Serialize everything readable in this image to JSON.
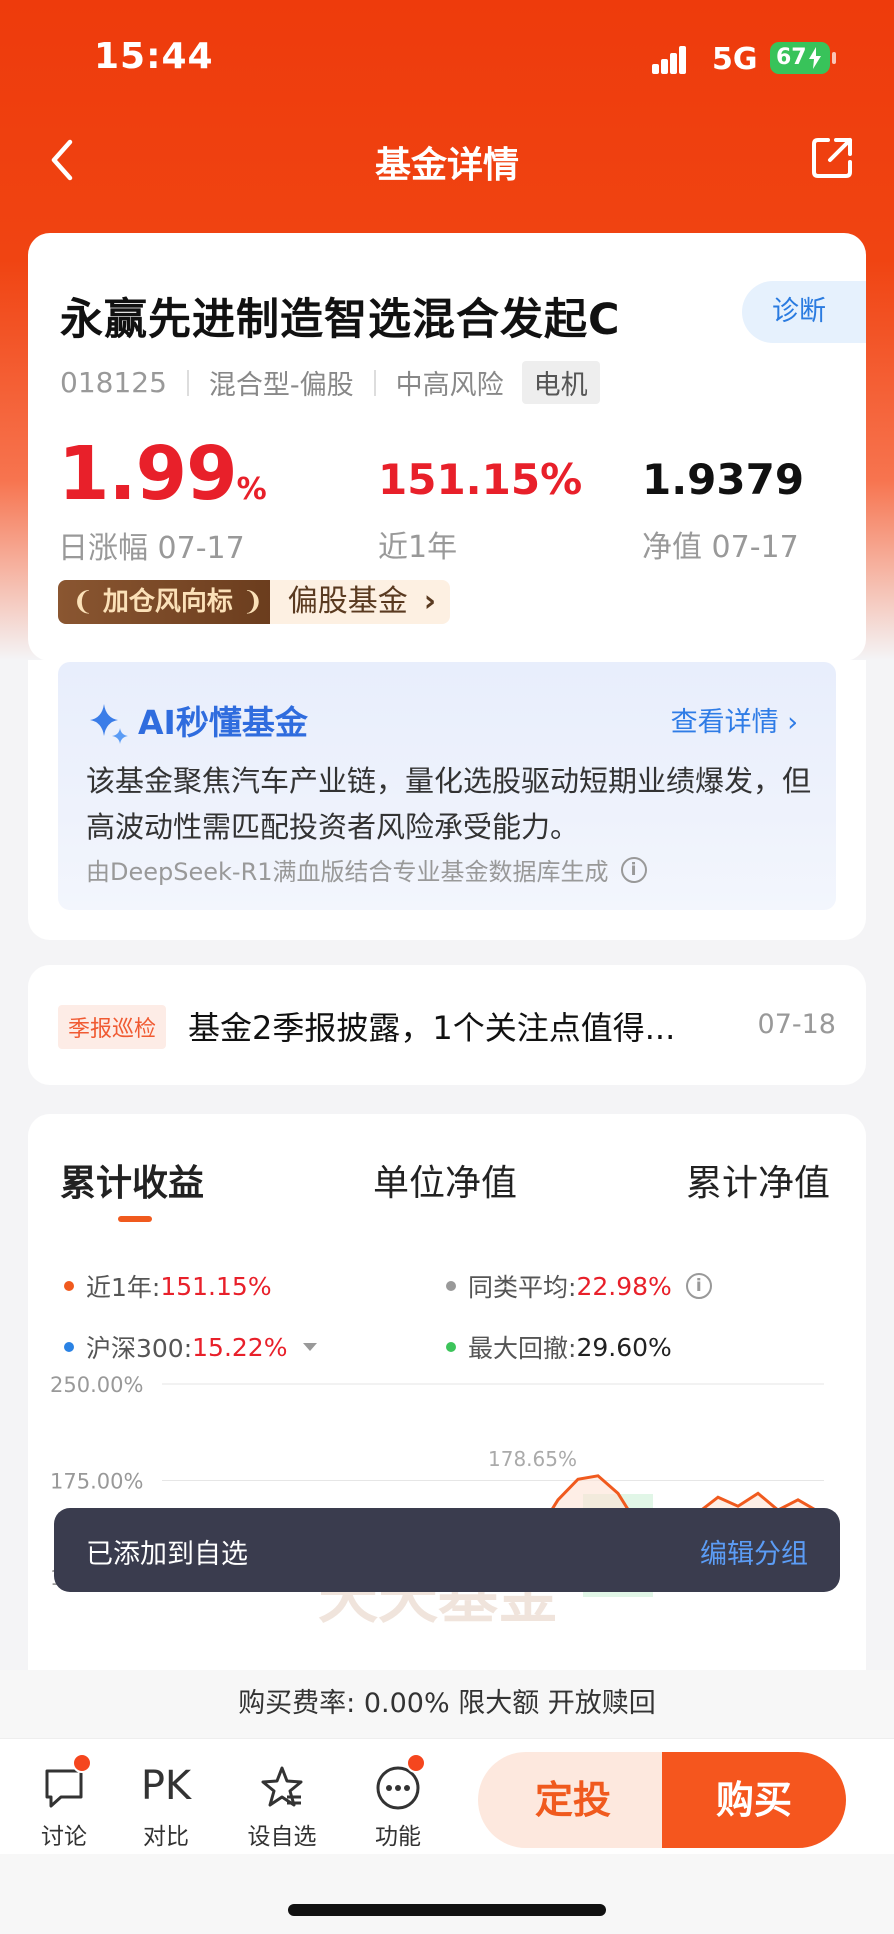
{
  "status_bar": {
    "time": "15:44",
    "network": "5G",
    "battery": "67"
  },
  "nav": {
    "title": "基金详情"
  },
  "fund": {
    "name": "永赢先进制造智选混合发起C",
    "diagnose_label": "诊断",
    "code": "018125",
    "type": "混合型-偏股",
    "risk": "中高风险",
    "sector_tag": "电机",
    "daily_change": "1.99",
    "daily_change_unit": "%",
    "daily_change_label": "日涨幅 07-17",
    "one_year_return": "151.15%",
    "one_year_label": "近1年",
    "nav_value": "1.9379",
    "nav_label": "净值 07-17",
    "badge_primary": "加仓风向标",
    "badge_secondary": "偏股基金"
  },
  "ai_summary": {
    "title": "AI秒懂基金",
    "more_label": "查看详情",
    "text": "该基金聚焦汽车产业链，量化选股驱动短期业绩爆发，但高波动性需匹配投资者风险承受能力。",
    "source": "由DeepSeek-R1满血版结合专业基金数据库生成"
  },
  "news": {
    "tag": "季报巡检",
    "title": "基金2季报披露，1个关注点值得...",
    "date": "07-18"
  },
  "chart_section": {
    "tabs": [
      "累计收益",
      "单位净值",
      "累计净值"
    ],
    "legend": {
      "fund_label": "近1年:",
      "fund_value": "151.15%",
      "peer_label": "同类平均:",
      "peer_value": "22.98%",
      "index_label": "沪深300:",
      "index_value": "15.22%",
      "drawdown_label": "最大回撤:",
      "drawdown_value": "29.60%"
    },
    "colors": {
      "fund": "#f05a1e",
      "peer": "#999999",
      "index": "#2a82e4",
      "drawdown": "#3cc45a"
    }
  },
  "chart_data": {
    "type": "line",
    "y_tick_labels": [
      "250.00%",
      "175.00%",
      "100.00%"
    ],
    "ylim": [
      100,
      250
    ],
    "annotation": "178.65%",
    "watermark": "天天基金",
    "series": [
      {
        "name": "近1年",
        "values": [
          95,
          118,
          135,
          160,
          176,
          178.65,
          165,
          140,
          95,
          118,
          150,
          162,
          155,
          165,
          152,
          160,
          151
        ]
      }
    ]
  },
  "toast": {
    "message": "已添加到自选",
    "action": "编辑分组"
  },
  "fee_bar": {
    "text": "购买费率: 0.00% 限大额 开放赎回"
  },
  "bottom_bar": {
    "tools": [
      {
        "label": "讨论",
        "icon": "chat-icon"
      },
      {
        "label": "对比",
        "icon": "pk-icon",
        "glyph": "PK"
      },
      {
        "label": "设自选",
        "icon": "star-add-icon"
      },
      {
        "label": "功能",
        "icon": "more-icon"
      }
    ],
    "dingtou_label": "定投",
    "buy_label": "购买"
  }
}
